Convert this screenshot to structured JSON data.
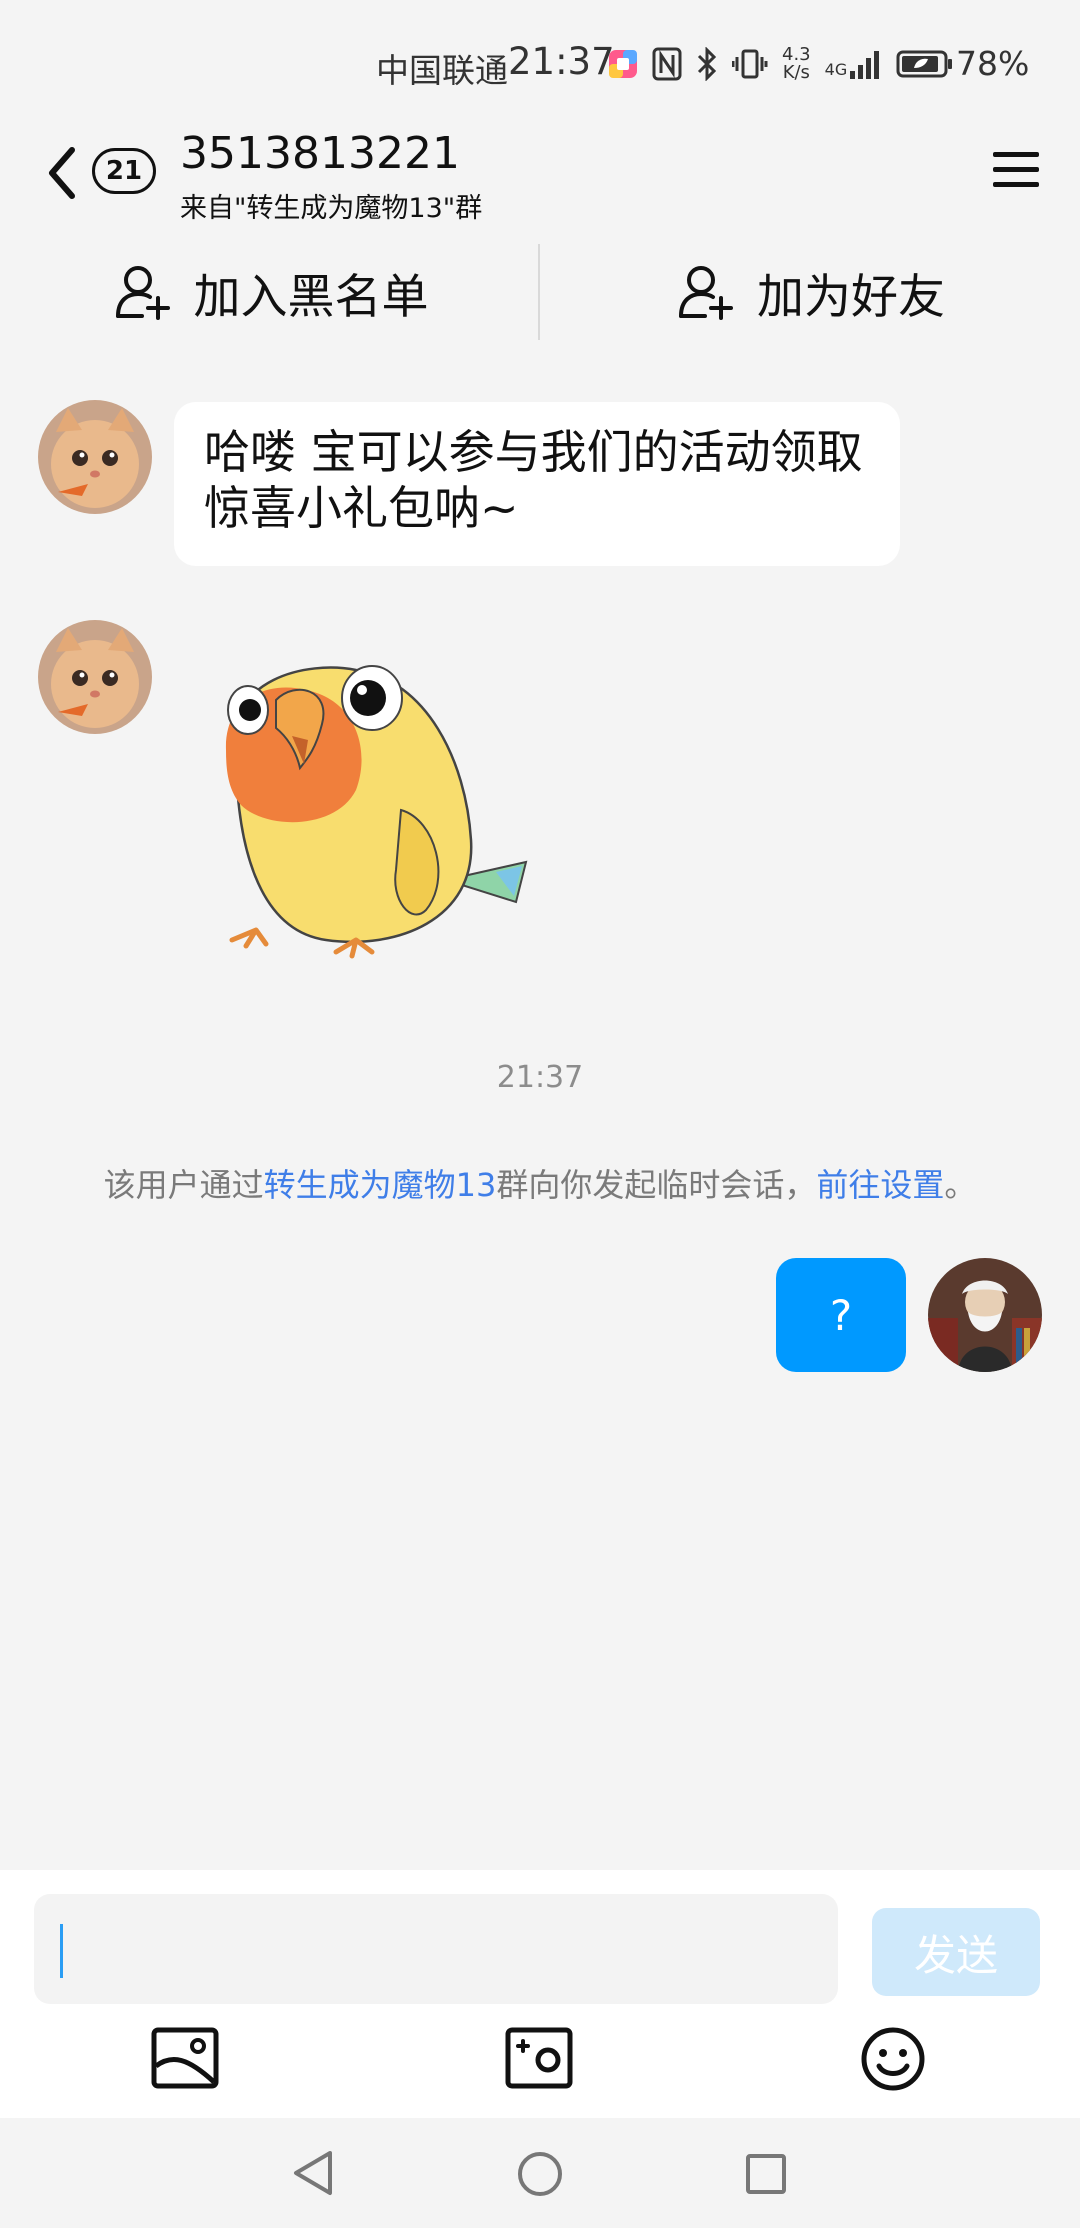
{
  "status_bar": {
    "carrier": "中国联通",
    "time": "21:37",
    "net_speed_value": "4.3",
    "net_speed_unit": "K/s",
    "network_type": "4G",
    "battery": "78%"
  },
  "header": {
    "unread_count": "21",
    "contact_number": "3513813221",
    "subtitle": "来自\"转生成为魔物13\"群"
  },
  "actions": {
    "blacklist_label": "加入黑名单",
    "add_friend_label": "加为好友"
  },
  "messages": {
    "incoming_text": "哈喽 宝可以参与我们的活动领取惊喜小礼包呐~",
    "timestamp": "21:37",
    "system_note": {
      "prefix": "该用户通过",
      "group_link": "转生成为魔物13",
      "middle": "群向你发起临时会话，",
      "settings_link": "前往设置",
      "suffix": "。"
    },
    "outgoing_text": "?"
  },
  "composer": {
    "input_value": "",
    "send_label": "发送"
  },
  "colors": {
    "accent_blue": "#0099ff",
    "link_blue": "#3f7ee8",
    "send_disabled": "#cfe9fb",
    "background": "#f4f4f4"
  }
}
